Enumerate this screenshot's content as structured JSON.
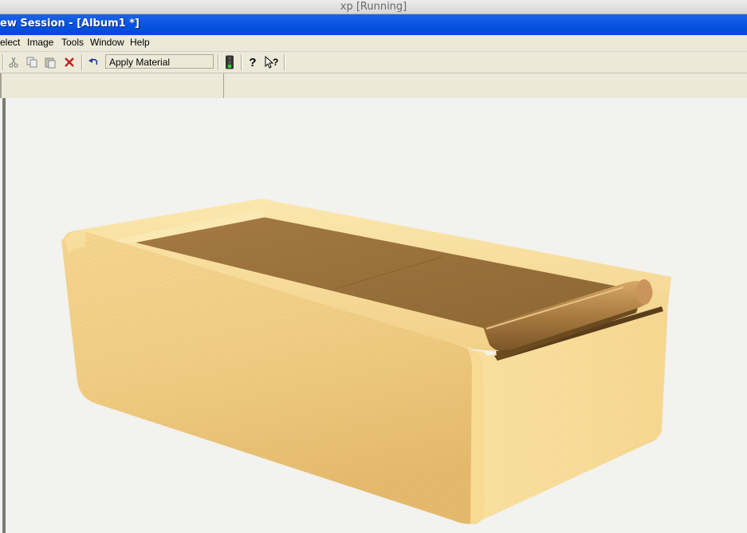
{
  "host": {
    "title": "xp [Running]"
  },
  "window": {
    "title": "ew Session - [Album1 *]"
  },
  "menu": {
    "items": [
      "elect",
      "Image",
      "Tools",
      "Window",
      "Help"
    ]
  },
  "toolbar": {
    "material_value": "Apply Material",
    "icons": [
      "scissors-icon",
      "copy-icon",
      "paste-icon",
      "delete-icon",
      "undo-icon",
      "traffic-light-icon",
      "help-icon",
      "context-help-icon"
    ]
  },
  "colors": {
    "titlebar": "#0a55e2",
    "chrome": "#ece9d8",
    "wood_light": "#f6d98f",
    "wood_mid": "#e9c47a",
    "wood_dark": "#a87e45"
  }
}
